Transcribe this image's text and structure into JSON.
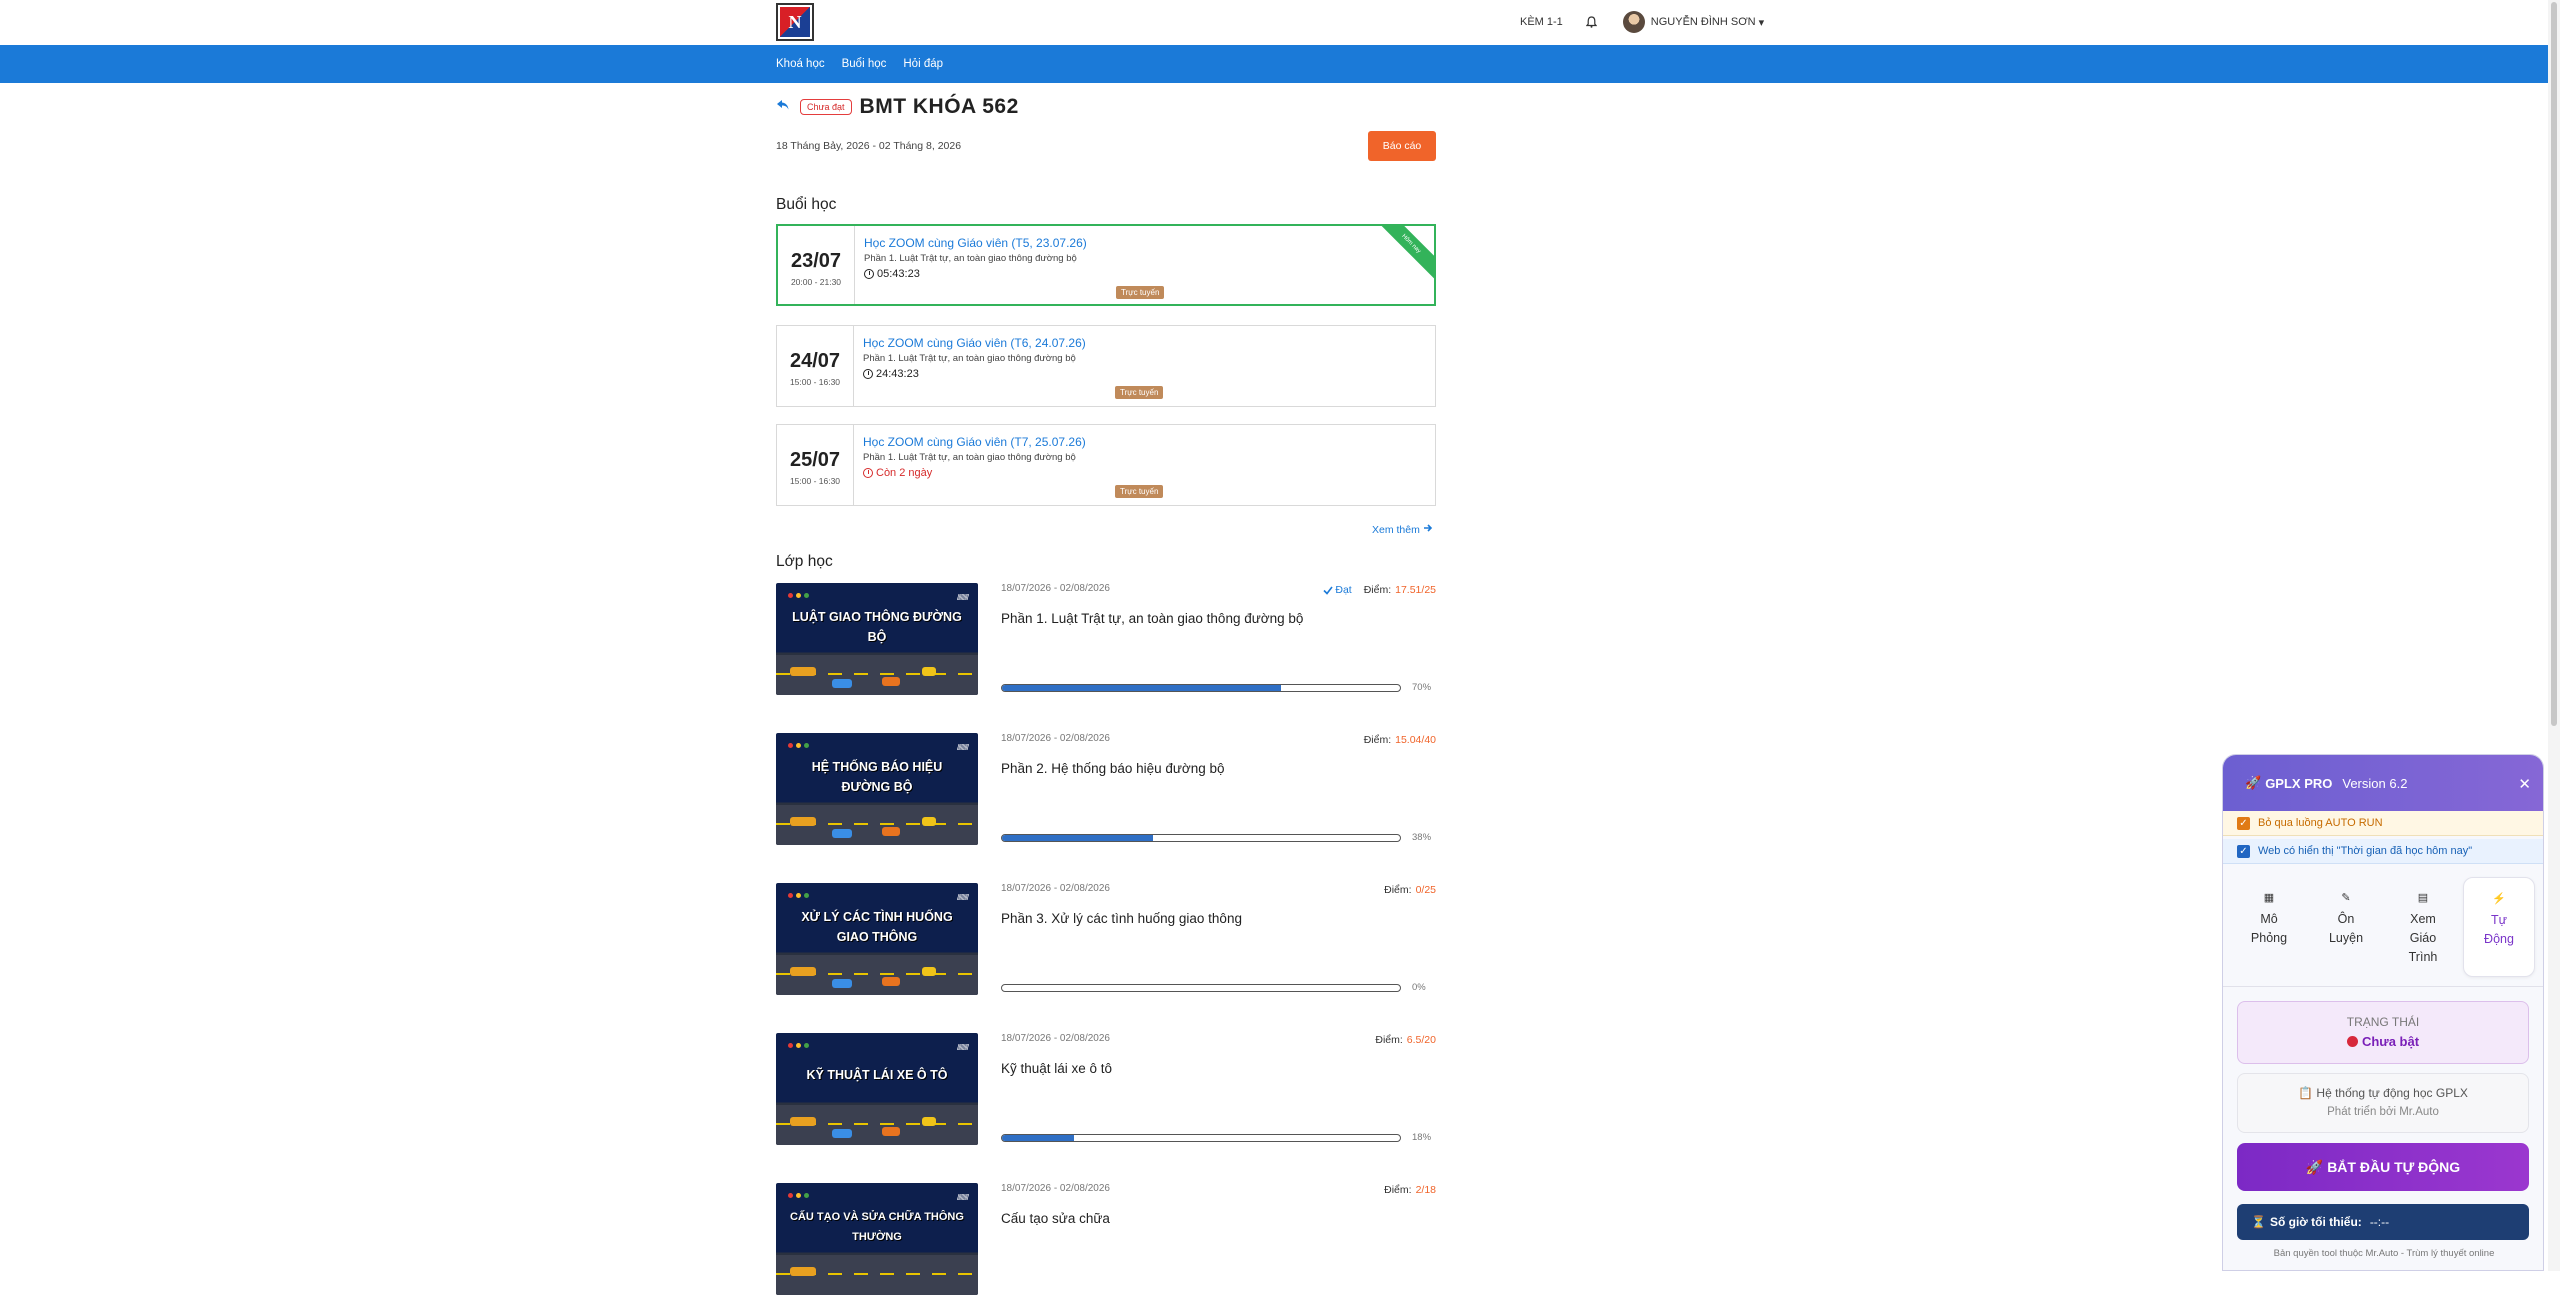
{
  "header": {
    "logo_text": "N",
    "kem_label": "KÈM 1-1",
    "user_name": "NGUYỄN ĐÌNH SƠN",
    "user_caret": "▾"
  },
  "nav": {
    "items": [
      "Khoá học",
      "Buổi học",
      "Hỏi đáp"
    ]
  },
  "course": {
    "status_badge": "Chưa đạt",
    "title": "BMT KHÓA 562",
    "date_range": "18 Tháng Bảy, 2026 - 02 Tháng 8, 2026",
    "report_button": "Báo cáo"
  },
  "sessions_section": {
    "heading": "Buổi học",
    "today_ribbon": "Hôm nay",
    "more_link": "Xem thêm",
    "items": [
      {
        "day": "23/07",
        "time": "20:00 - 21:30",
        "title": "Học ZOOM cùng Giáo viên (T5, 23.07.26)",
        "sub": "Phần 1. Luật Trật tự, an toàn giao thông đường bộ",
        "timer": "05:43:23",
        "badge": "Trực tuyến"
      },
      {
        "day": "24/07",
        "time": "15:00 - 16:30",
        "title": "Học ZOOM cùng Giáo viên (T6, 24.07.26)",
        "sub": "Phần 1. Luật Trật tự, an toàn giao thông đường bộ",
        "timer": "24:43:23",
        "badge": "Trực tuyến"
      },
      {
        "day": "25/07",
        "time": "15:00 - 16:30",
        "title": "Học ZOOM cùng Giáo viên (T7, 25.07.26)",
        "sub": "Phần 1. Luật Trật tự, an toàn giao thông đường bộ",
        "timer": "Còn 2 ngày",
        "badge": "Trực tuyến"
      }
    ]
  },
  "classes_section": {
    "heading": "Lớp học",
    "score_label": "Điểm:",
    "passed_label": "Đạt",
    "items": [
      {
        "thumb_title": "LUẬT GIAO THÔNG ĐƯỜNG BỘ",
        "dates": "18/07/2026 - 02/08/2026",
        "name": "Phần 1. Luật Trật tự, an toàn giao thông đường bộ",
        "score": "17.51/25",
        "progress": 0.7,
        "progress_label": "70%",
        "passed": true
      },
      {
        "thumb_title": "HỆ THỐNG BÁO HIỆU ĐƯỜNG BỘ",
        "dates": "18/07/2026 - 02/08/2026",
        "name": "Phần 2. Hệ thống báo hiệu đường bộ",
        "score": "15.04/40",
        "progress": 0.38,
        "progress_label": "38%",
        "passed": false
      },
      {
        "thumb_title": "XỬ LÝ CÁC TÌNH HUỐNG GIAO THÔNG",
        "dates": "18/07/2026 - 02/08/2026",
        "name": "Phần 3. Xử lý các tình huống giao thông",
        "score": "0/25",
        "progress": 0.0,
        "progress_label": "0%",
        "passed": false
      },
      {
        "thumb_title": "KỸ THUẬT LÁI XE Ô TÔ",
        "dates": "18/07/2026 - 02/08/2026",
        "name": "Kỹ thuật lái xe ô tô",
        "score": "6.5/20",
        "progress": 0.18,
        "progress_label": "18%",
        "passed": false
      },
      {
        "thumb_title": "CẤU TẠO VÀ SỬA CHỮA THÔNG THƯỜNG",
        "dates": "18/07/2026 - 02/08/2026",
        "name": "Cấu tạo sửa chữa",
        "score": "2/18",
        "progress": null,
        "progress_label": "",
        "passed": false
      }
    ]
  },
  "extension_panel": {
    "app_name": "GPLX PRO",
    "version": "Version 6.2",
    "close": "✕",
    "option_skip": "Bỏ qua luồng AUTO RUN",
    "option_web": "Web có hiển thị \"Thời gian đã học hôm nay\"",
    "tabs": [
      {
        "icon": "▦",
        "label": "Mô Phỏng"
      },
      {
        "icon": "✎",
        "label": "Ôn Luyện"
      },
      {
        "icon": "▤",
        "label": "Xem Giáo Trình"
      },
      {
        "icon": "⚡",
        "label": "Tự Động"
      }
    ],
    "status_label": "TRẠNG THÁI",
    "status_value": "Chưa bật",
    "info_line1": "Hệ thống tự động học GPLX",
    "info_line2": "Phát triển bởi Mr.Auto",
    "start_button": "BẮT ĐẦU TỰ ĐỘNG",
    "min_hours_label": "Số giờ tối thiểu:",
    "min_hours_value": "--:--",
    "copyright": "Bản quyền tool thuộc Mr.Auto - Trùm lý thuyết online"
  },
  "colors": {
    "nav_blue": "#1b7ad8",
    "report_orange": "#f0642a",
    "today_green": "#33b35a",
    "panel_purple": "#7c29c5"
  }
}
